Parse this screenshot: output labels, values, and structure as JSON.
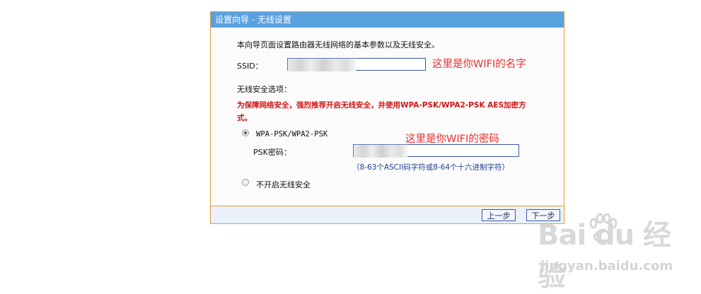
{
  "dialog": {
    "title": "设置向导 - 无线设置",
    "intro": "本向导页面设置路由器无线网络的基本参数以及无线安全。",
    "ssid_label": "SSID：",
    "security_heading": "无线安全选项：",
    "security_warning_line1": "为保障网络安全，强烈推荐开启无线安全，并使用WPA-PSK/WPA2-PSK AES加密方",
    "security_warning_line2": "式。",
    "options": {
      "wpa_label": "WPA-PSK/WPA2-PSK",
      "wpa_selected": true,
      "psk_label": "PSK密码：",
      "psk_hint": "（8-63个ASCII码字符或8-64个十六进制字符）",
      "disable_label": "不开启无线安全",
      "disable_selected": false
    },
    "buttons": {
      "prev": "上一步",
      "next": "下一步"
    }
  },
  "annotations": {
    "ssid_note": "这里是你WIFI的名字",
    "password_note": "这里是你WIFI的密码",
    "color": "#e8312f"
  },
  "watermark": {
    "main": "Bai du 经验",
    "sub": "jingyan.baidu.com"
  },
  "colors": {
    "titlebar": "#5aa1e0",
    "border": "#e39b3a",
    "warning": "#d11616",
    "input_border": "#3d57a8"
  }
}
